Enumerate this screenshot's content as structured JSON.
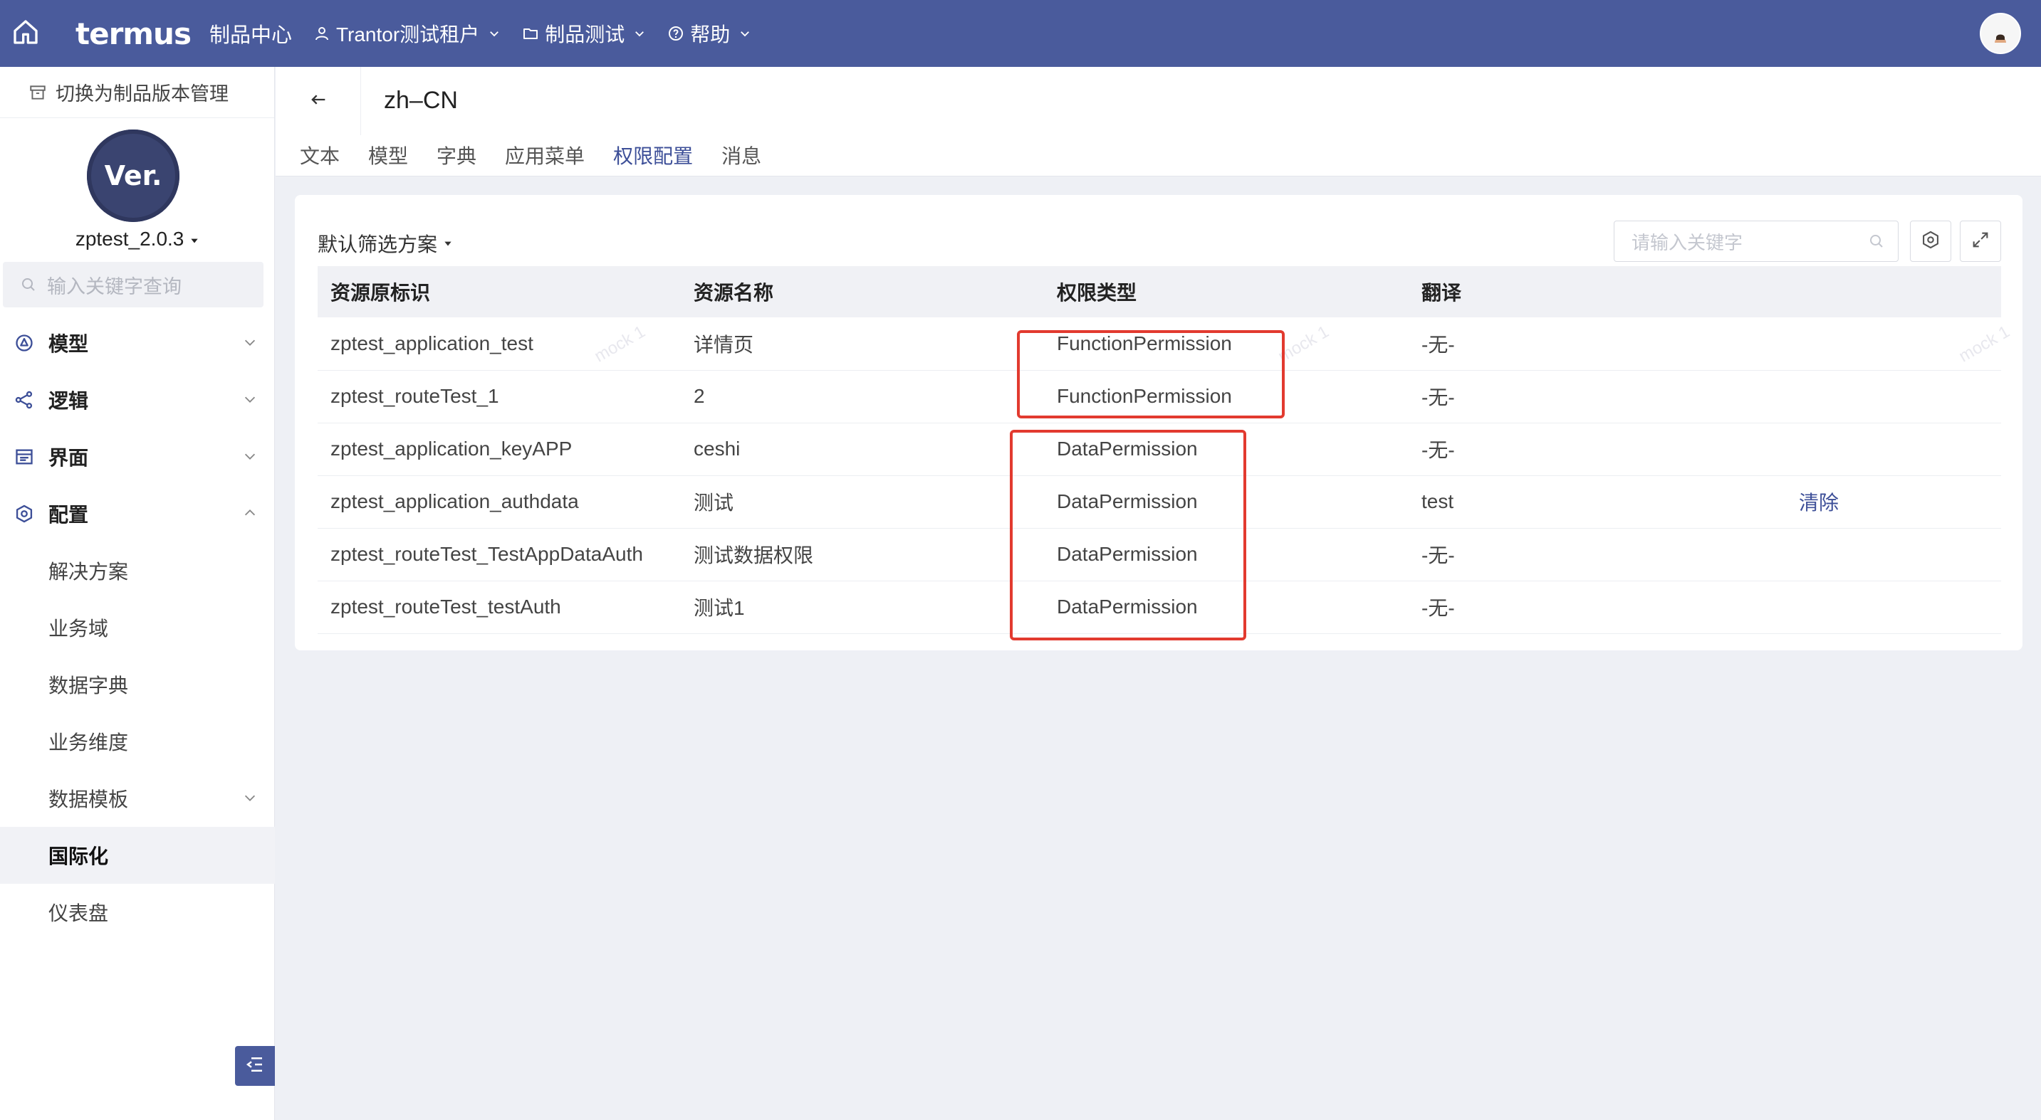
{
  "topbar": {
    "logo": "termus",
    "title": "制品中心",
    "tenant": "Trantor测试租户",
    "project": "制品测试",
    "help": "帮助"
  },
  "sidebar": {
    "switch_label": "切换为制品版本管理",
    "badge_text": "Ver.",
    "version_name": "zptest_2.0.3",
    "search_placeholder": "输入关键字查询",
    "menu": [
      {
        "label": "模型",
        "icon": "model-icon"
      },
      {
        "label": "逻辑",
        "icon": "logic-icon"
      },
      {
        "label": "界面",
        "icon": "ui-icon"
      },
      {
        "label": "配置",
        "icon": "config-icon"
      }
    ],
    "submenu": [
      "解决方案",
      "业务域",
      "数据字典",
      "业务维度",
      "数据模板",
      "国际化",
      "仪表盘"
    ]
  },
  "header": {
    "title": "zh–CN",
    "tabs": [
      "文本",
      "模型",
      "字典",
      "应用菜单",
      "权限配置",
      "消息"
    ],
    "active_tab": "权限配置"
  },
  "card": {
    "filter_label": "默认筛选方案",
    "search_placeholder": "请输入关键字",
    "columns": [
      "资源原标识",
      "资源名称",
      "权限类型",
      "翻译"
    ],
    "rows": [
      {
        "id": "zptest_application_test",
        "name": "详情页",
        "type": "FunctionPermission",
        "translation": "-无-",
        "action": ""
      },
      {
        "id": "zptest_routeTest_1",
        "name": "2",
        "type": "FunctionPermission",
        "translation": "-无-",
        "action": ""
      },
      {
        "id": "zptest_application_keyAPP",
        "name": "ceshi",
        "type": "DataPermission",
        "translation": "-无-",
        "action": ""
      },
      {
        "id": "zptest_application_authdata",
        "name": "测试",
        "type": "DataPermission",
        "translation": "test",
        "action": "清除"
      },
      {
        "id": "zptest_routeTest_TestAppDataAuth",
        "name": "测试数据权限",
        "type": "DataPermission",
        "translation": "-无-",
        "action": ""
      },
      {
        "id": "zptest_routeTest_testAuth",
        "name": "测试1",
        "type": "DataPermission",
        "translation": "-无-",
        "action": ""
      }
    ],
    "watermark": "mock 1"
  },
  "colors": {
    "topbar": "#4a5b9c",
    "accent": "#3d4f98",
    "highlight": "#e23a2f"
  }
}
